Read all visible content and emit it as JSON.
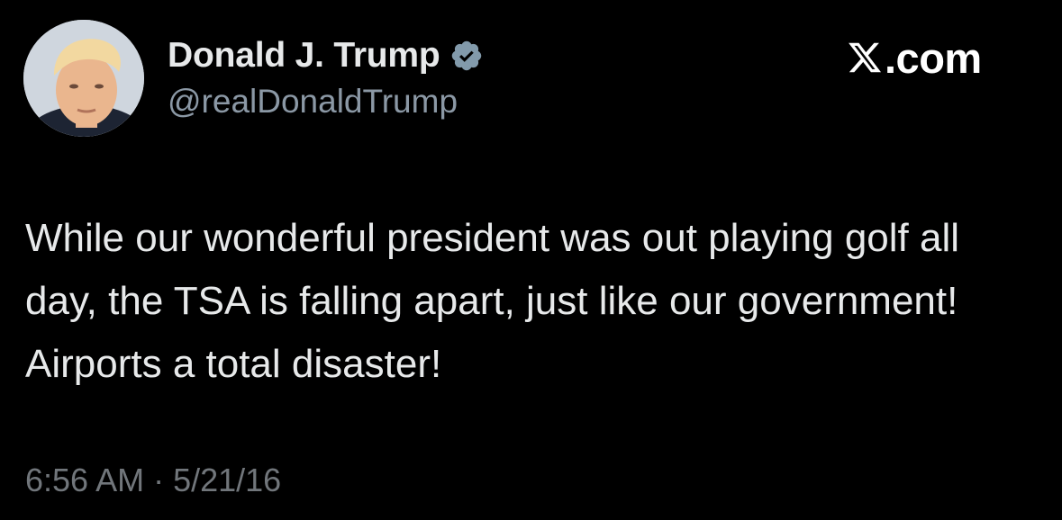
{
  "tweet": {
    "author": {
      "display_name": "Donald J. Trump",
      "handle": "@realDonaldTrump",
      "verified": true,
      "verified_icon": "verified-badge-icon"
    },
    "brand": {
      "logo_icon": "x-logo-icon",
      "text": ".com"
    },
    "text": "While our wonderful president was out playing golf all day, the TSA is falling apart, just like our government! Airports a total disaster!",
    "time": "6:56 AM",
    "separator": "·",
    "date": "5/21/16"
  },
  "colors": {
    "background": "#000000",
    "primary_text": "#e7e9ea",
    "secondary_text": "#8b98a5",
    "meta_text": "#71767b",
    "verified_badge": "#829aab"
  }
}
